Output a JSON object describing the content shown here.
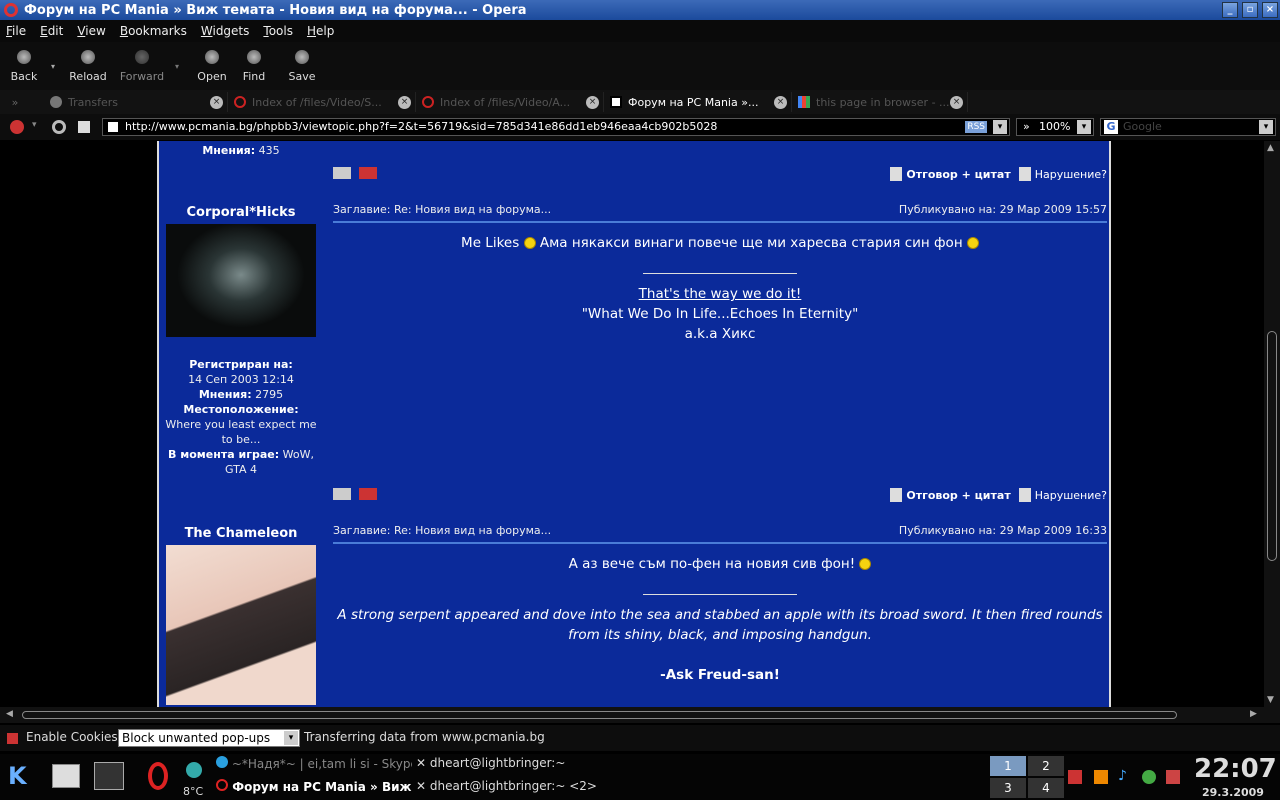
{
  "window": {
    "title": "Форум на PC Mania » Виж темата - Новия вид на форума... - Opera"
  },
  "menu": [
    "File",
    "Edit",
    "View",
    "Bookmarks",
    "Widgets",
    "Tools",
    "Help"
  ],
  "toolbar": {
    "back": "Back",
    "reload": "Reload",
    "forward": "Forward",
    "open": "Open",
    "find": "Find",
    "save": "Save"
  },
  "tabs": [
    {
      "label": "Transfers",
      "active": false
    },
    {
      "label": "Index of /files/Video/S...",
      "active": false
    },
    {
      "label": "Index of /files/Video/A...",
      "active": false
    },
    {
      "label": "Форум на PC Mania »...",
      "active": true
    },
    {
      "label": "this page in browser - ...",
      "active": false
    }
  ],
  "address": {
    "url": "http://www.pcmania.bg/phpbb3/viewtopic.php?f=2&t=56719&sid=785d341e86dd1eb946eaa4cb902b5028",
    "rss": "RSS",
    "zoom": "100%",
    "search_placeholder": "Google"
  },
  "forum": {
    "top_stat_label": "Мнения:",
    "top_stat_value": "435",
    "posts": [
      {
        "author": "Corporal*Hicks",
        "registered_label": "Регистриран на:",
        "registered": "14 Сеп 2003 12:14",
        "posts_label": "Мнения:",
        "posts": "2795",
        "location_label": "Местоположение:",
        "location": "Where you least expect me to be...",
        "playing_label": "В момента играе:",
        "playing": "WoW, GTA 4",
        "subject": "Заглавие: Re: Новия вид на форума...",
        "date": "Публикувано на: 29 Мар 2009 15:57",
        "text_a": "Me Likes",
        "text_b": "Ама някакси винаги повече ще ми харесва стария син фон",
        "sig1": "That's the way we do it!",
        "sig2": "\"What We Do In Life...Echoes In Eternity\"",
        "sig3": "a.k.a Хикс"
      },
      {
        "author": "The Chameleon",
        "subject": "Заглавие: Re: Новия вид на форума...",
        "date": "Публикувано на: 29 Мар 2009 16:33",
        "text": "А аз вече съм по-фен на новия сив фон!",
        "sig1": "A strong serpent appeared and dove into the sea and stabbed an apple with its broad sword. It then fired rounds from its shiny, black, and imposing handgun.",
        "sig2": "-Ask Freud-san!"
      }
    ],
    "quote_reply": "Отговор + цитат",
    "report": "Нарушение?"
  },
  "status": {
    "cookies": "Enable Cookies",
    "popups": "Block unwanted pop-ups",
    "message": "Transferring data from www.pcmania.bg"
  },
  "taskbar": {
    "temp": "8°C",
    "tasks": [
      "~*Надя*~ | ei,tam li si - Skype",
      "dheart@lightbringer:~",
      "Форум на PC Mania » Виж",
      "dheart@lightbringer:~ <2>"
    ],
    "desktops": [
      "1",
      "2",
      "3",
      "4"
    ],
    "time": "22:07",
    "date": "29.3.2009"
  }
}
